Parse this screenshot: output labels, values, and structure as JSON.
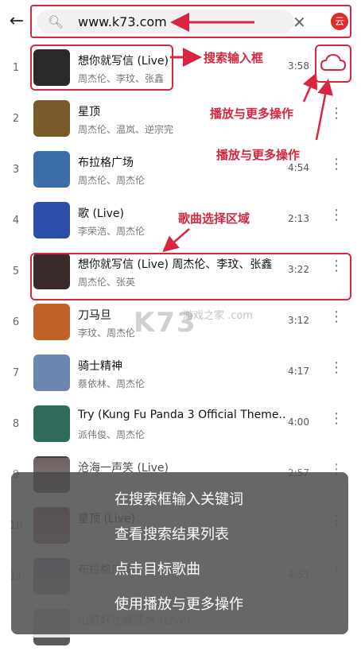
{
  "search": {
    "query": "www.k73.com",
    "cloud_label": "云"
  },
  "songs": [
    {
      "idx": "1",
      "title": "想你就写信 (Live)",
      "artist": "周杰伦、李玟、张鑫",
      "dur": "3:58"
    },
    {
      "idx": "2",
      "title": "星顶",
      "artist": "周杰伦、温岚、逆宗完",
      "dur": ""
    },
    {
      "idx": "3",
      "title": "布拉格广场",
      "artist": "周杰伦、周杰伦",
      "dur": "4:54"
    },
    {
      "idx": "4",
      "title": "歌 (Live)",
      "artist": "李荣浩、周杰伦",
      "dur": "2:13"
    },
    {
      "idx": "5",
      "title": "想你就写信 (Live) 周杰伦、李玟、张鑫",
      "artist": "周杰伦、张英",
      "dur": "3:22"
    },
    {
      "idx": "6",
      "title": "刀马旦",
      "artist": "李玟、周杰伦",
      "dur": "3:12"
    },
    {
      "idx": "7",
      "title": "骑士精神",
      "artist": "蔡依林、周杰伦",
      "dur": "4:17"
    },
    {
      "idx": "8",
      "title": "Try (Kung Fu Panda 3 Official Theme...",
      "artist": "派伟俊、周杰伦",
      "dur": "4:00"
    },
    {
      "idx": "9",
      "title": "沧海一声笑 (Live)",
      "artist": "",
      "dur": "2:57"
    },
    {
      "idx": "10",
      "title": "星顶 (Live)",
      "artist": "",
      "dur": ""
    },
    {
      "idx": "11",
      "title": "布拉格广场",
      "artist": "",
      "dur": "4:53"
    },
    {
      "idx": "",
      "title": "山歌好比春江水 (Live)",
      "artist": "",
      "dur": ""
    }
  ],
  "annotations": {
    "search_box": "搜索输入框",
    "play_more_1": "播放与更多操作",
    "play_more_2": "播放与更多操作",
    "song_area": "歌曲选择区域"
  },
  "watermark": {
    "brand": "K73",
    "sub": "游戏之家 .com"
  },
  "overlay_steps": [
    "在搜索框输入关键词",
    "查看搜索结果列表",
    "点击目标歌曲",
    "使用播放与更多操作"
  ],
  "colors": {
    "accent": "#d7263d",
    "cloud": "#e02b2b"
  }
}
